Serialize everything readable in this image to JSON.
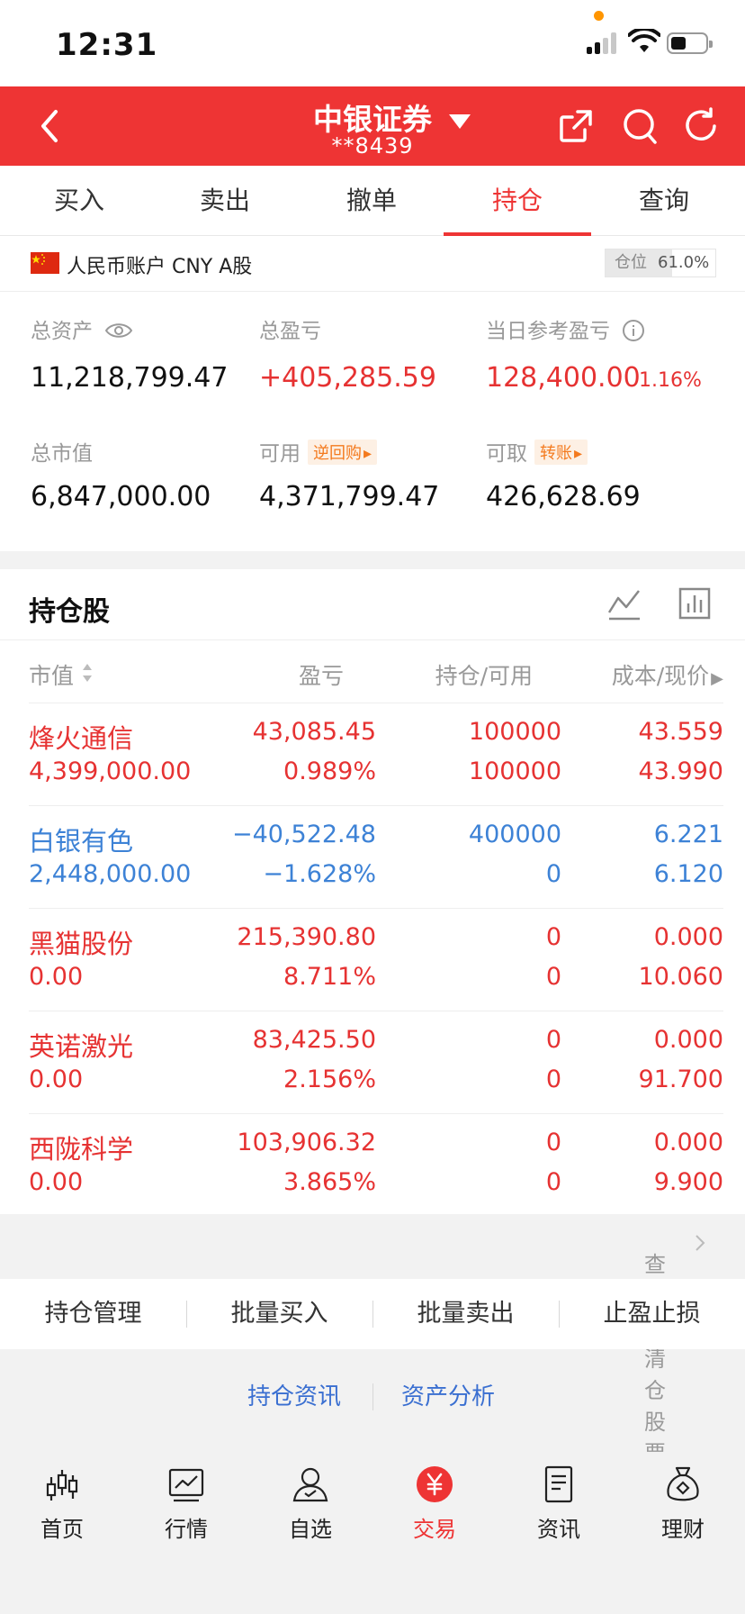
{
  "status_bar": {
    "time": "12:31"
  },
  "header": {
    "broker": "中银证券",
    "account": "**8439"
  },
  "tabs": [
    "买入",
    "卖出",
    "撤单",
    "持仓",
    "查询"
  ],
  "active_tab": "持仓",
  "account": {
    "label": "人民币账户 CNY A股",
    "position_label": "仓位",
    "position_value": "61.0%",
    "position_ratio": 0.61
  },
  "metrics": {
    "total_assets": {
      "label": "总资产",
      "value": "11,218,799.47"
    },
    "total_pnl": {
      "label": "总盈亏",
      "value": "+405,285.59"
    },
    "daily_pnl": {
      "label": "当日参考盈亏",
      "value": "128,400.00",
      "pct": "1.16%"
    },
    "market_value": {
      "label": "总市值",
      "value": "6,847,000.00"
    },
    "available": {
      "label": "可用",
      "pill": "逆回购",
      "value": "4,371,799.47"
    },
    "withdrawable": {
      "label": "可取",
      "pill": "转账",
      "value": "426,628.69"
    }
  },
  "holdings": {
    "title": "持仓股",
    "headers": {
      "market_value": "市值",
      "pnl": "盈亏",
      "position": "持仓/可用",
      "cost": "成本/现价"
    },
    "rows": [
      {
        "name": "烽火通信",
        "market_value": "4,399,000.00",
        "pnl": "43,085.45",
        "pnl_pct": "0.989%",
        "position": "100000",
        "available": "100000",
        "cost": "43.559",
        "price": "43.990",
        "color": "#e63232"
      },
      {
        "name": "白银有色",
        "market_value": "2,448,000.00",
        "pnl": "−40,522.48",
        "pnl_pct": "−1.628%",
        "position": "400000",
        "available": "0",
        "cost": "6.221",
        "price": "6.120",
        "color": "#3d82d6"
      },
      {
        "name": "黑猫股份",
        "market_value": "0.00",
        "pnl": "215,390.80",
        "pnl_pct": "8.711%",
        "position": "0",
        "available": "0",
        "cost": "0.000",
        "price": "10.060",
        "color": "#e63232"
      },
      {
        "name": "英诺激光",
        "market_value": "0.00",
        "pnl": "83,425.50",
        "pnl_pct": "2.156%",
        "position": "0",
        "available": "0",
        "cost": "0.000",
        "price": "91.700",
        "color": "#e63232"
      },
      {
        "name": "西陇科学",
        "market_value": "0.00",
        "pnl": "103,906.32",
        "pnl_pct": "3.865%",
        "position": "0",
        "available": "0",
        "cost": "0.000",
        "price": "9.900",
        "color": "#e63232"
      }
    ],
    "cleared_link": "查看已清仓股票"
  },
  "actions": [
    "持仓管理",
    "批量买入",
    "批量卖出",
    "止盈止损"
  ],
  "links": [
    "持仓资讯",
    "资产分析"
  ],
  "bottom_nav": [
    {
      "label": "首页",
      "icon": "candlestick-icon"
    },
    {
      "label": "行情",
      "icon": "trend-chart-icon"
    },
    {
      "label": "自选",
      "icon": "user-icon"
    },
    {
      "label": "交易",
      "icon": "yuan-icon"
    },
    {
      "label": "资讯",
      "icon": "document-icon"
    },
    {
      "label": "理财",
      "icon": "money-bag-icon"
    }
  ],
  "colors": {
    "brand": "#ee3434",
    "up": "#e63232",
    "down": "#3d82d6",
    "pill": "#f47a1e"
  }
}
